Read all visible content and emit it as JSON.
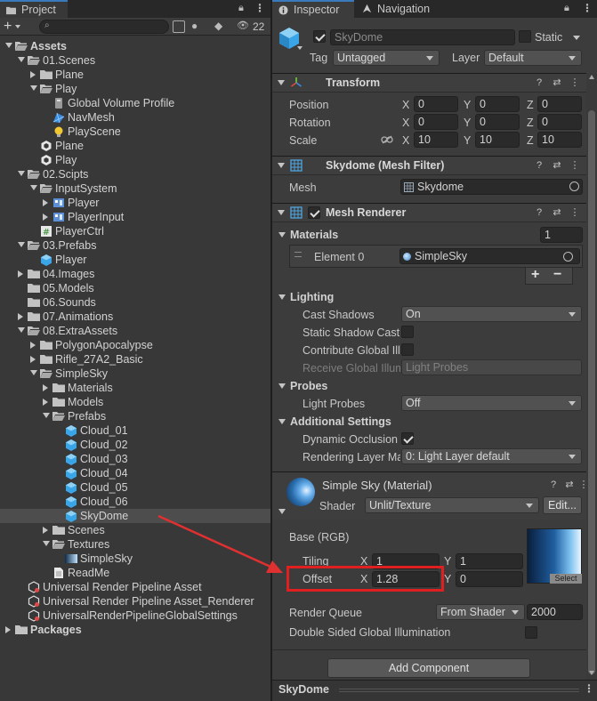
{
  "project": {
    "tab_label": "Project",
    "search_placeholder": "",
    "hidden_count": "22",
    "tree": [
      {
        "label": "Assets",
        "depth": 0,
        "arrow": "open",
        "icon": "folder-open",
        "bold": true
      },
      {
        "label": "01.Scenes",
        "depth": 1,
        "arrow": "open",
        "icon": "folder-open"
      },
      {
        "label": "Plane",
        "depth": 2,
        "arrow": "closed",
        "icon": "folder"
      },
      {
        "label": "Play",
        "depth": 2,
        "arrow": "open",
        "icon": "folder-open"
      },
      {
        "label": "Global Volume Profile",
        "depth": 3,
        "arrow": "none",
        "icon": "volume"
      },
      {
        "label": "NavMesh",
        "depth": 3,
        "arrow": "none",
        "icon": "navmesh"
      },
      {
        "label": "PlayScene",
        "depth": 3,
        "arrow": "none",
        "icon": "lightbulb"
      },
      {
        "label": "Plane",
        "depth": 2,
        "arrow": "none",
        "icon": "unity"
      },
      {
        "label": "Play",
        "depth": 2,
        "arrow": "none",
        "icon": "unity"
      },
      {
        "label": "02.Scipts",
        "depth": 1,
        "arrow": "open",
        "icon": "folder-open"
      },
      {
        "label": "InputSystem",
        "depth": 2,
        "arrow": "open",
        "icon": "folder-open"
      },
      {
        "label": "Player",
        "depth": 3,
        "arrow": "closed",
        "icon": "input"
      },
      {
        "label": "PlayerInput",
        "depth": 3,
        "arrow": "closed",
        "icon": "input"
      },
      {
        "label": "PlayerCtrl",
        "depth": 2,
        "arrow": "none",
        "icon": "script"
      },
      {
        "label": "03.Prefabs",
        "depth": 1,
        "arrow": "open",
        "icon": "folder-open"
      },
      {
        "label": "Player",
        "depth": 2,
        "arrow": "none",
        "icon": "prefab"
      },
      {
        "label": "04.Images",
        "depth": 1,
        "arrow": "closed",
        "icon": "folder"
      },
      {
        "label": "05.Models",
        "depth": 1,
        "arrow": "none",
        "icon": "folder"
      },
      {
        "label": "06.Sounds",
        "depth": 1,
        "arrow": "none",
        "icon": "folder"
      },
      {
        "label": "07.Animations",
        "depth": 1,
        "arrow": "closed",
        "icon": "folder"
      },
      {
        "label": "08.ExtraAssets",
        "depth": 1,
        "arrow": "open",
        "icon": "folder-open"
      },
      {
        "label": "PolygonApocalypse",
        "depth": 2,
        "arrow": "closed",
        "icon": "folder"
      },
      {
        "label": "Rifle_27A2_Basic",
        "depth": 2,
        "arrow": "closed",
        "icon": "folder"
      },
      {
        "label": "SimpleSky",
        "depth": 2,
        "arrow": "open",
        "icon": "folder-open"
      },
      {
        "label": "Materials",
        "depth": 3,
        "arrow": "closed",
        "icon": "folder"
      },
      {
        "label": "Models",
        "depth": 3,
        "arrow": "closed",
        "icon": "folder"
      },
      {
        "label": "Prefabs",
        "depth": 3,
        "arrow": "open",
        "icon": "folder-open"
      },
      {
        "label": "Cloud_01",
        "depth": 4,
        "arrow": "none",
        "icon": "prefab"
      },
      {
        "label": "Cloud_02",
        "depth": 4,
        "arrow": "none",
        "icon": "prefab"
      },
      {
        "label": "Cloud_03",
        "depth": 4,
        "arrow": "none",
        "icon": "prefab"
      },
      {
        "label": "Cloud_04",
        "depth": 4,
        "arrow": "none",
        "icon": "prefab"
      },
      {
        "label": "Cloud_05",
        "depth": 4,
        "arrow": "none",
        "icon": "prefab"
      },
      {
        "label": "Cloud_06",
        "depth": 4,
        "arrow": "none",
        "icon": "prefab"
      },
      {
        "label": "SkyDome",
        "depth": 4,
        "arrow": "none",
        "icon": "prefab",
        "selected": true
      },
      {
        "label": "Scenes",
        "depth": 3,
        "arrow": "closed",
        "icon": "folder"
      },
      {
        "label": "Textures",
        "depth": 3,
        "arrow": "open",
        "icon": "folder-open"
      },
      {
        "label": "SimpleSky",
        "depth": 4,
        "arrow": "none",
        "icon": "texture"
      },
      {
        "label": "ReadMe",
        "depth": 3,
        "arrow": "none",
        "icon": "doc"
      },
      {
        "label": "Universal Render Pipeline Asset",
        "depth": 1,
        "arrow": "none",
        "icon": "urp"
      },
      {
        "label": "Universal Render Pipeline Asset_Renderer",
        "depth": 1,
        "arrow": "none",
        "icon": "urp"
      },
      {
        "label": "UniversalRenderPipelineGlobalSettings",
        "depth": 1,
        "arrow": "none",
        "icon": "urp"
      },
      {
        "label": "Packages",
        "depth": 0,
        "arrow": "closed",
        "icon": "folder",
        "bold": true
      }
    ]
  },
  "inspector": {
    "tab_inspector": "Inspector",
    "tab_navigation": "Navigation",
    "object_name": "SkyDome",
    "static_label": "Static",
    "tag_label": "Tag",
    "tag_value": "Untagged",
    "layer_label": "Layer",
    "layer_value": "Default",
    "transform": {
      "title": "Transform",
      "rows": [
        {
          "label": "Position",
          "x": "0",
          "y": "0",
          "z": "0"
        },
        {
          "label": "Rotation",
          "x": "0",
          "y": "0",
          "z": "0"
        },
        {
          "label": "Scale",
          "x": "10",
          "y": "10",
          "z": "10"
        }
      ],
      "axis_x": "X",
      "axis_y": "Y",
      "axis_z": "Z"
    },
    "mesh_filter": {
      "title": "Skydome (Mesh Filter)",
      "mesh_label": "Mesh",
      "mesh_value": "Skydome"
    },
    "mesh_renderer": {
      "title": "Mesh Renderer",
      "materials_label": "Materials",
      "materials_count": "1",
      "element_label": "Element 0",
      "element_value": "SimpleSky",
      "plus": "+",
      "minus": "−",
      "lighting_label": "Lighting",
      "cast_shadows_label": "Cast Shadows",
      "cast_shadows_value": "On",
      "static_shadow_label": "Static Shadow Cast",
      "contribute_gi_label": "Contribute Global Ill",
      "receive_gi_label": "Receive Global Illum",
      "receive_gi_value": "Light Probes",
      "probes_label": "Probes",
      "light_probes_label": "Light Probes",
      "light_probes_value": "Off",
      "additional_label": "Additional Settings",
      "dynamic_occlusion_label": "Dynamic Occlusion",
      "rendering_layer_label": "Rendering Layer Ma",
      "rendering_layer_value": "0: Light Layer default"
    },
    "material": {
      "title": "Simple Sky (Material)",
      "shader_label": "Shader",
      "shader_value": "Unlit/Texture",
      "edit_button": "Edit...",
      "base_label": "Base (RGB)",
      "tiling_label": "Tiling",
      "tiling_x": "1",
      "tiling_y": "1",
      "offset_label": "Offset",
      "offset_x": "1.28",
      "offset_y": "0",
      "axis_x": "X",
      "axis_y": "Y",
      "select_label": "Select",
      "render_queue_label": "Render Queue",
      "render_queue_mode": "From Shader",
      "render_queue_value": "2000",
      "double_sided_label": "Double Sided Global Illumination"
    },
    "add_component": "Add Component",
    "footer_title": "SkyDome"
  },
  "colors": {
    "accent": "#3a79bb",
    "highlight_box": "#e02020",
    "arrow": "#e03030"
  }
}
